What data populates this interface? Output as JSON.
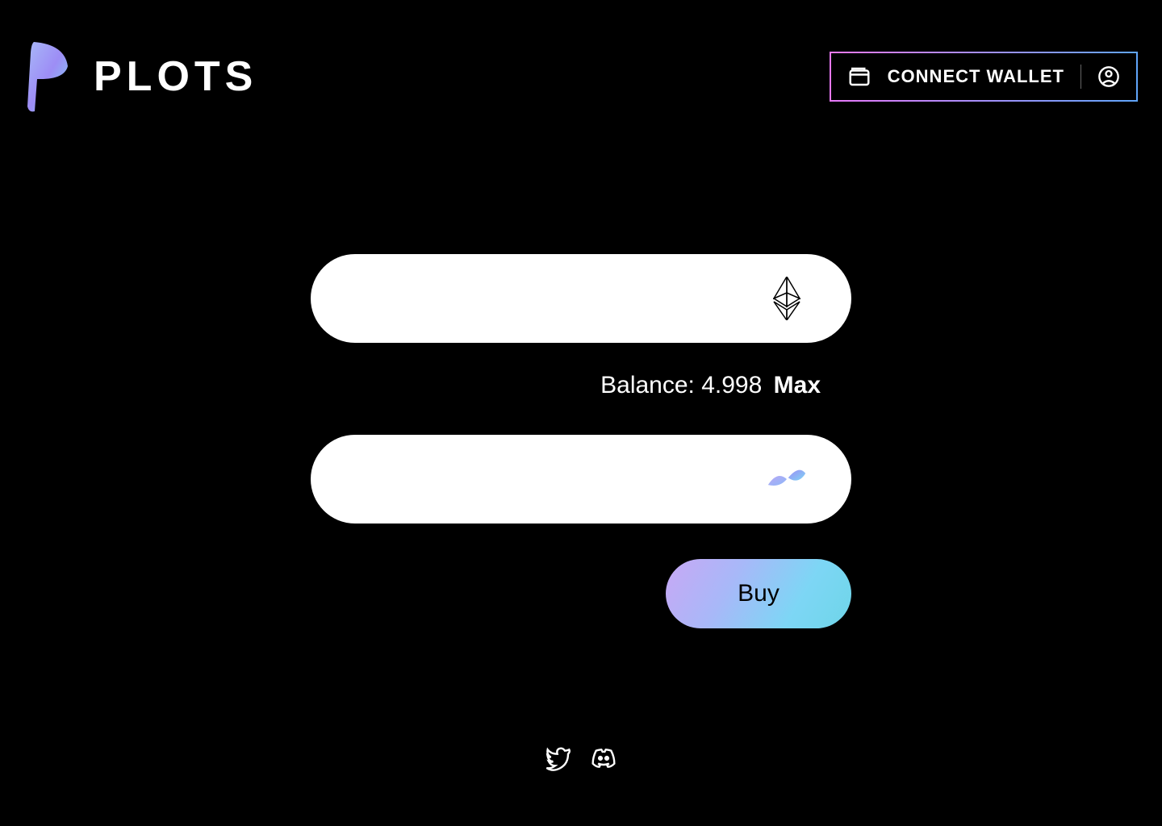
{
  "header": {
    "logo_text": "PLOTS",
    "connect_wallet_label": "CONNECT WALLET"
  },
  "swap": {
    "from_token": "ETH",
    "from_value": "",
    "to_token": "PLOTS",
    "to_value": "",
    "balance_label": "Balance:",
    "balance_value": "4.998",
    "max_label": "Max",
    "buy_label": "Buy"
  },
  "footer": {
    "twitter": "twitter",
    "discord": "discord"
  },
  "colors": {
    "gradient_start": "#c8a8f5",
    "gradient_end": "#6ed5e8",
    "border_gradient_start": "#e879f9",
    "border_gradient_end": "#60a5fa"
  }
}
